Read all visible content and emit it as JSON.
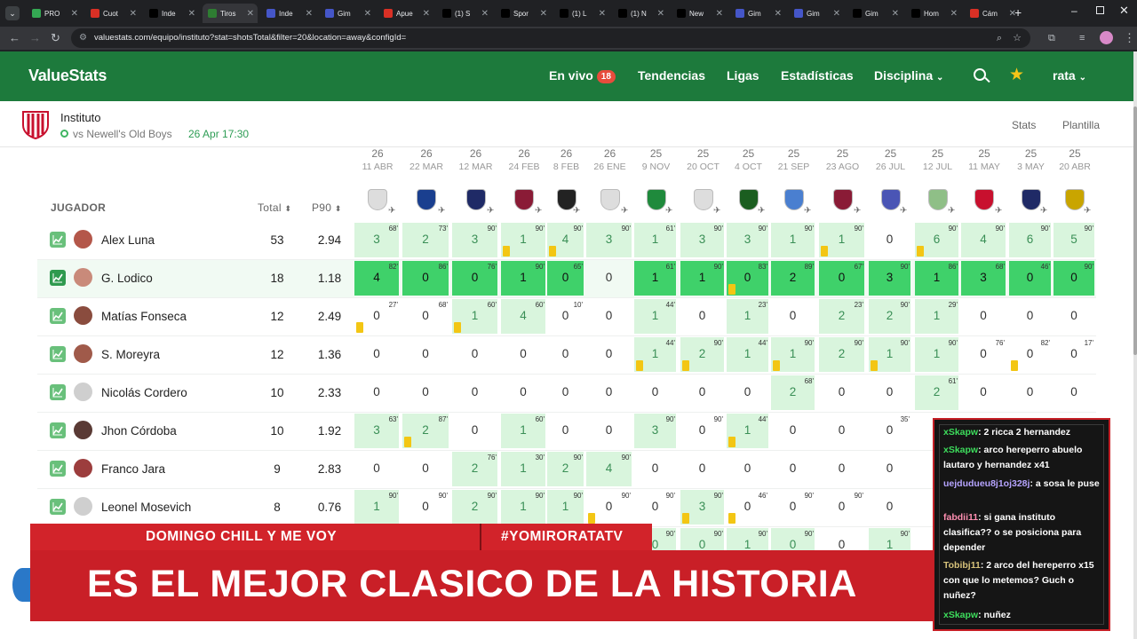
{
  "browser": {
    "tabs": [
      {
        "label": "PRO",
        "color": "#34a853"
      },
      {
        "label": "Cuot",
        "color": "#d93025"
      },
      {
        "label": "Inde",
        "color": "#000000"
      },
      {
        "label": "Tiros",
        "color": "#2e7d32"
      },
      {
        "label": "Inde",
        "color": "#4556c8"
      },
      {
        "label": "Gim",
        "color": "#4556c8"
      },
      {
        "label": "Apue",
        "color": "#d93025"
      },
      {
        "label": "(1) S",
        "color": "#000000"
      },
      {
        "label": "Spor",
        "color": "#000000"
      },
      {
        "label": "(1) L",
        "color": "#000000"
      },
      {
        "label": "(1) N",
        "color": "#000000"
      },
      {
        "label": "New",
        "color": "#000000"
      },
      {
        "label": "Gim",
        "color": "#4556c8"
      },
      {
        "label": "Gim",
        "color": "#4556c8"
      },
      {
        "label": "Gim",
        "color": "#000000"
      },
      {
        "label": "Hom",
        "color": "#000000"
      },
      {
        "label": "Cám",
        "color": "#d93025"
      }
    ],
    "url": "valuestats.com/equipo/instituto?stat=shotsTotal&filter=20&location=away&configId="
  },
  "header": {
    "logo": "ValueStats",
    "nav": [
      "En vivo",
      "Tendencias",
      "Ligas",
      "Estadísticas",
      "Disciplina"
    ],
    "live_count": "18",
    "user": "rata"
  },
  "team": {
    "name": "Instituto",
    "next_match": "vs Newell's Old Boys",
    "next_date": "26 Apr 17:30",
    "links": [
      "Stats",
      "Plantilla"
    ]
  },
  "table": {
    "headers": {
      "player": "JUGADOR",
      "total": "Total",
      "p90": "P90"
    },
    "matches": [
      {
        "year": "26",
        "date": "11 ABR",
        "crest": "#dddddd"
      },
      {
        "year": "26",
        "date": "22 MAR",
        "crest": "#1a3f8f"
      },
      {
        "year": "26",
        "date": "12 MAR",
        "crest": "#1f2a66"
      },
      {
        "year": "26",
        "date": "24 FEB",
        "crest": "#8a1b36"
      },
      {
        "year": "26",
        "date": "8 FEB",
        "crest": "#222222"
      },
      {
        "year": "26",
        "date": "26 ENE",
        "crest": "#dddddd"
      },
      {
        "year": "25",
        "date": "9 NOV",
        "crest": "#1f8a3c"
      },
      {
        "year": "25",
        "date": "20 OCT",
        "crest": "#dddddd"
      },
      {
        "year": "25",
        "date": "4 OCT",
        "crest": "#1b5e20"
      },
      {
        "year": "25",
        "date": "21 SEP",
        "crest": "#4a7fd0"
      },
      {
        "year": "25",
        "date": "23 AGO",
        "crest": "#8a1b36"
      },
      {
        "year": "25",
        "date": "26 JUL",
        "crest": "#4a55b5"
      },
      {
        "year": "25",
        "date": "12 JUL",
        "crest": "#8fbf87"
      },
      {
        "year": "25",
        "date": "11 MAY",
        "crest": "#c8102e"
      },
      {
        "year": "25",
        "date": "3 MAY",
        "crest": "#1f2a66"
      },
      {
        "year": "25",
        "date": "20 ABR",
        "crest": "#c9a500"
      }
    ],
    "players": [
      {
        "name": "Alex Luna",
        "total": "53",
        "p90": "2.94",
        "avatar": "#b4574a",
        "highlight": false,
        "cells": [
          {
            "v": "3",
            "m": "68'",
            "c": "l"
          },
          {
            "v": "2",
            "m": "73'",
            "c": "l"
          },
          {
            "v": "3",
            "m": "90'",
            "c": "l"
          },
          {
            "v": "1",
            "m": "90'",
            "c": "l",
            "s": true
          },
          {
            "v": "4",
            "m": "90'",
            "c": "l",
            "s": true
          },
          {
            "v": "3",
            "m": "90'",
            "c": "l"
          },
          {
            "v": "1",
            "m": "61'",
            "c": "l"
          },
          {
            "v": "3",
            "m": "90'",
            "c": "l"
          },
          {
            "v": "3",
            "m": "90'",
            "c": "l"
          },
          {
            "v": "1",
            "m": "90'",
            "c": "l"
          },
          {
            "v": "1",
            "m": "90'",
            "c": "l",
            "s": true
          },
          {
            "v": "0",
            "m": "",
            "c": "n"
          },
          {
            "v": "6",
            "m": "90'",
            "c": "l",
            "s": true
          },
          {
            "v": "4",
            "m": "90'",
            "c": "l"
          },
          {
            "v": "6",
            "m": "90'",
            "c": "l"
          },
          {
            "v": "5",
            "m": "90'",
            "c": "l"
          }
        ]
      },
      {
        "name": "G. Lodico",
        "total": "18",
        "p90": "1.18",
        "avatar": "#c98a7a",
        "highlight": true,
        "cells": [
          {
            "v": "4",
            "m": "82'",
            "c": "d"
          },
          {
            "v": "0",
            "m": "86'",
            "c": "d"
          },
          {
            "v": "0",
            "m": "76'",
            "c": "d"
          },
          {
            "v": "1",
            "m": "90'",
            "c": "d"
          },
          {
            "v": "0",
            "m": "65'",
            "c": "d"
          },
          {
            "v": "0",
            "m": "",
            "c": "n"
          },
          {
            "v": "1",
            "m": "61'",
            "c": "d"
          },
          {
            "v": "1",
            "m": "90'",
            "c": "d"
          },
          {
            "v": "0",
            "m": "83'",
            "c": "d",
            "s": true
          },
          {
            "v": "2",
            "m": "89'",
            "c": "d"
          },
          {
            "v": "0",
            "m": "67'",
            "c": "d"
          },
          {
            "v": "3",
            "m": "90'",
            "c": "d"
          },
          {
            "v": "1",
            "m": "86'",
            "c": "d"
          },
          {
            "v": "3",
            "m": "68'",
            "c": "d"
          },
          {
            "v": "0",
            "m": "46'",
            "c": "d"
          },
          {
            "v": "0",
            "m": "90'",
            "c": "d"
          }
        ]
      },
      {
        "name": "Matías Fonseca",
        "total": "12",
        "p90": "2.49",
        "avatar": "#8a4c3e",
        "highlight": false,
        "cells": [
          {
            "v": "0",
            "m": "27'",
            "c": "n",
            "s": true
          },
          {
            "v": "0",
            "m": "68'",
            "c": "n"
          },
          {
            "v": "1",
            "m": "60'",
            "c": "l",
            "s": true
          },
          {
            "v": "4",
            "m": "60'",
            "c": "l"
          },
          {
            "v": "0",
            "m": "10'",
            "c": "n"
          },
          {
            "v": "0",
            "m": "",
            "c": "n"
          },
          {
            "v": "1",
            "m": "44'",
            "c": "l"
          },
          {
            "v": "0",
            "m": "",
            "c": "n"
          },
          {
            "v": "1",
            "m": "23'",
            "c": "l"
          },
          {
            "v": "0",
            "m": "",
            "c": "n"
          },
          {
            "v": "2",
            "m": "23'",
            "c": "l"
          },
          {
            "v": "2",
            "m": "90'",
            "c": "l"
          },
          {
            "v": "1",
            "m": "29'",
            "c": "l"
          },
          {
            "v": "0",
            "m": "",
            "c": "n"
          },
          {
            "v": "0",
            "m": "",
            "c": "n"
          },
          {
            "v": "0",
            "m": "",
            "c": "n"
          }
        ]
      },
      {
        "name": "S. Moreyra",
        "total": "12",
        "p90": "1.36",
        "avatar": "#a05a4a",
        "highlight": false,
        "cells": [
          {
            "v": "0",
            "m": "",
            "c": "n"
          },
          {
            "v": "0",
            "m": "",
            "c": "n"
          },
          {
            "v": "0",
            "m": "",
            "c": "n"
          },
          {
            "v": "0",
            "m": "",
            "c": "n"
          },
          {
            "v": "0",
            "m": "",
            "c": "n"
          },
          {
            "v": "0",
            "m": "",
            "c": "n"
          },
          {
            "v": "1",
            "m": "44'",
            "c": "l",
            "s": true
          },
          {
            "v": "2",
            "m": "90'",
            "c": "l",
            "s": true
          },
          {
            "v": "1",
            "m": "44'",
            "c": "l"
          },
          {
            "v": "1",
            "m": "90'",
            "c": "l",
            "s": true
          },
          {
            "v": "2",
            "m": "90'",
            "c": "l"
          },
          {
            "v": "1",
            "m": "90'",
            "c": "l",
            "s": true
          },
          {
            "v": "1",
            "m": "90'",
            "c": "l"
          },
          {
            "v": "0",
            "m": "76'",
            "c": "n"
          },
          {
            "v": "0",
            "m": "82'",
            "c": "n",
            "s": true
          },
          {
            "v": "0",
            "m": "17'",
            "c": "n"
          }
        ]
      },
      {
        "name": "Nicolás Cordero",
        "total": "10",
        "p90": "2.33",
        "avatar": "#cfcfcf",
        "highlight": false,
        "cells": [
          {
            "v": "0",
            "m": "",
            "c": "n"
          },
          {
            "v": "0",
            "m": "",
            "c": "n"
          },
          {
            "v": "0",
            "m": "",
            "c": "n"
          },
          {
            "v": "0",
            "m": "",
            "c": "n"
          },
          {
            "v": "0",
            "m": "",
            "c": "n"
          },
          {
            "v": "0",
            "m": "",
            "c": "n"
          },
          {
            "v": "0",
            "m": "",
            "c": "n"
          },
          {
            "v": "0",
            "m": "",
            "c": "n"
          },
          {
            "v": "0",
            "m": "",
            "c": "n"
          },
          {
            "v": "2",
            "m": "68'",
            "c": "l"
          },
          {
            "v": "0",
            "m": "",
            "c": "n"
          },
          {
            "v": "0",
            "m": "",
            "c": "n"
          },
          {
            "v": "2",
            "m": "61'",
            "c": "l"
          },
          {
            "v": "0",
            "m": "",
            "c": "n"
          },
          {
            "v": "0",
            "m": "",
            "c": "n"
          },
          {
            "v": "0",
            "m": "",
            "c": "n"
          }
        ]
      },
      {
        "name": "Jhon Córdoba",
        "total": "10",
        "p90": "1.92",
        "avatar": "#5a3a35",
        "highlight": false,
        "cells": [
          {
            "v": "3",
            "m": "63'",
            "c": "l"
          },
          {
            "v": "2",
            "m": "87'",
            "c": "l",
            "s": true
          },
          {
            "v": "0",
            "m": "",
            "c": "n"
          },
          {
            "v": "1",
            "m": "60'",
            "c": "l"
          },
          {
            "v": "0",
            "m": "",
            "c": "n"
          },
          {
            "v": "0",
            "m": "",
            "c": "n"
          },
          {
            "v": "3",
            "m": "90'",
            "c": "l"
          },
          {
            "v": "0",
            "m": "90'",
            "c": "n"
          },
          {
            "v": "1",
            "m": "44'",
            "c": "l",
            "s": true
          },
          {
            "v": "0",
            "m": "",
            "c": "n"
          },
          {
            "v": "0",
            "m": "",
            "c": "n"
          },
          {
            "v": "0",
            "m": "35'",
            "c": "n"
          },
          {
            "v": "",
            "m": "",
            "c": "n"
          },
          {
            "v": "",
            "m": "",
            "c": "n"
          },
          {
            "v": "",
            "m": "",
            "c": "n"
          },
          {
            "v": "",
            "m": "",
            "c": "n"
          }
        ]
      },
      {
        "name": "Franco Jara",
        "total": "9",
        "p90": "2.83",
        "avatar": "#9c3d3d",
        "highlight": false,
        "cells": [
          {
            "v": "0",
            "m": "",
            "c": "n"
          },
          {
            "v": "0",
            "m": "",
            "c": "n"
          },
          {
            "v": "2",
            "m": "76'",
            "c": "l"
          },
          {
            "v": "1",
            "m": "30'",
            "c": "l"
          },
          {
            "v": "2",
            "m": "90'",
            "c": "l"
          },
          {
            "v": "4",
            "m": "90'",
            "c": "l"
          },
          {
            "v": "0",
            "m": "",
            "c": "n"
          },
          {
            "v": "0",
            "m": "",
            "c": "n"
          },
          {
            "v": "0",
            "m": "",
            "c": "n"
          },
          {
            "v": "0",
            "m": "",
            "c": "n"
          },
          {
            "v": "0",
            "m": "",
            "c": "n"
          },
          {
            "v": "0",
            "m": "",
            "c": "n"
          },
          {
            "v": "",
            "m": "",
            "c": "n"
          },
          {
            "v": "",
            "m": "",
            "c": "n"
          },
          {
            "v": "",
            "m": "",
            "c": "n"
          },
          {
            "v": "",
            "m": "",
            "c": "n"
          }
        ]
      },
      {
        "name": "Leonel Mosevich",
        "total": "8",
        "p90": "0.76",
        "avatar": "#cfcfcf",
        "highlight": false,
        "cells": [
          {
            "v": "1",
            "m": "90'",
            "c": "l"
          },
          {
            "v": "0",
            "m": "90'",
            "c": "n"
          },
          {
            "v": "2",
            "m": "90'",
            "c": "l"
          },
          {
            "v": "1",
            "m": "90'",
            "c": "l"
          },
          {
            "v": "1",
            "m": "90'",
            "c": "l"
          },
          {
            "v": "0",
            "m": "90'",
            "c": "n",
            "s": true
          },
          {
            "v": "0",
            "m": "90'",
            "c": "n"
          },
          {
            "v": "3",
            "m": "90'",
            "c": "l",
            "s": true
          },
          {
            "v": "0",
            "m": "46'",
            "c": "n",
            "s": true
          },
          {
            "v": "0",
            "m": "90'",
            "c": "n"
          },
          {
            "v": "0",
            "m": "90'",
            "c": "n"
          },
          {
            "v": "0",
            "m": "",
            "c": "n"
          },
          {
            "v": "",
            "m": "",
            "c": "n"
          },
          {
            "v": "",
            "m": "",
            "c": "n"
          },
          {
            "v": "",
            "m": "",
            "c": "n"
          },
          {
            "v": "",
            "m": "",
            "c": "n"
          }
        ]
      }
    ],
    "peek_row": [
      {
        "v": "",
        "m": "",
        "c": "n"
      },
      {
        "v": "",
        "m": "",
        "c": "n"
      },
      {
        "v": "",
        "m": "",
        "c": "n"
      },
      {
        "v": "",
        "m": "",
        "c": "n"
      },
      {
        "v": "",
        "m": "",
        "c": "n"
      },
      {
        "v": "",
        "m": "",
        "c": "n"
      },
      {
        "v": "0",
        "m": "90'",
        "c": "l"
      },
      {
        "v": "0",
        "m": "90'",
        "c": "l"
      },
      {
        "v": "1",
        "m": "90'",
        "c": "l"
      },
      {
        "v": "0",
        "m": "90'",
        "c": "l"
      },
      {
        "v": "0",
        "m": "",
        "c": "n"
      },
      {
        "v": "1",
        "m": "90'",
        "c": "l"
      }
    ]
  },
  "overlay": {
    "banner_left": "DOMINGO CHILL Y ME VOY",
    "banner_right": "#YOMIRORATATV",
    "headline": "ES EL MEJOR CLASICO DE LA HISTORIA",
    "chat": [
      {
        "user": "xSkapw",
        "msg": ": 2 ricca 2 hernandez",
        "color": "#3ddc5c"
      },
      {
        "user": "xSkapw",
        "msg": ": arco hereperro abuelo lautaro y hernandez x41",
        "color": "#3ddc5c"
      },
      {
        "user": "uejduduеu8j1oj328j",
        "msg": ": a sosa le puse",
        "color": "#b6a4ff"
      },
      {
        "user": "fabdii11",
        "msg": ": si gana instituto clasifica?? o se posiciona para depender",
        "color": "#ff8fb1"
      },
      {
        "user": "Tobibj11",
        "msg": ": 2 arco del hereperro x15 con que lo metemos? Guch o nuñez?",
        "color": "#d7c27a"
      },
      {
        "user": "xSkapw",
        "msg": ": nuñez",
        "color": "#3ddc5c"
      }
    ]
  },
  "colors": {
    "brand": "#1d7a3c",
    "cell_light": "#d9f5dd",
    "cell_dark": "#3fd16a",
    "accent_red": "#d2232a"
  }
}
